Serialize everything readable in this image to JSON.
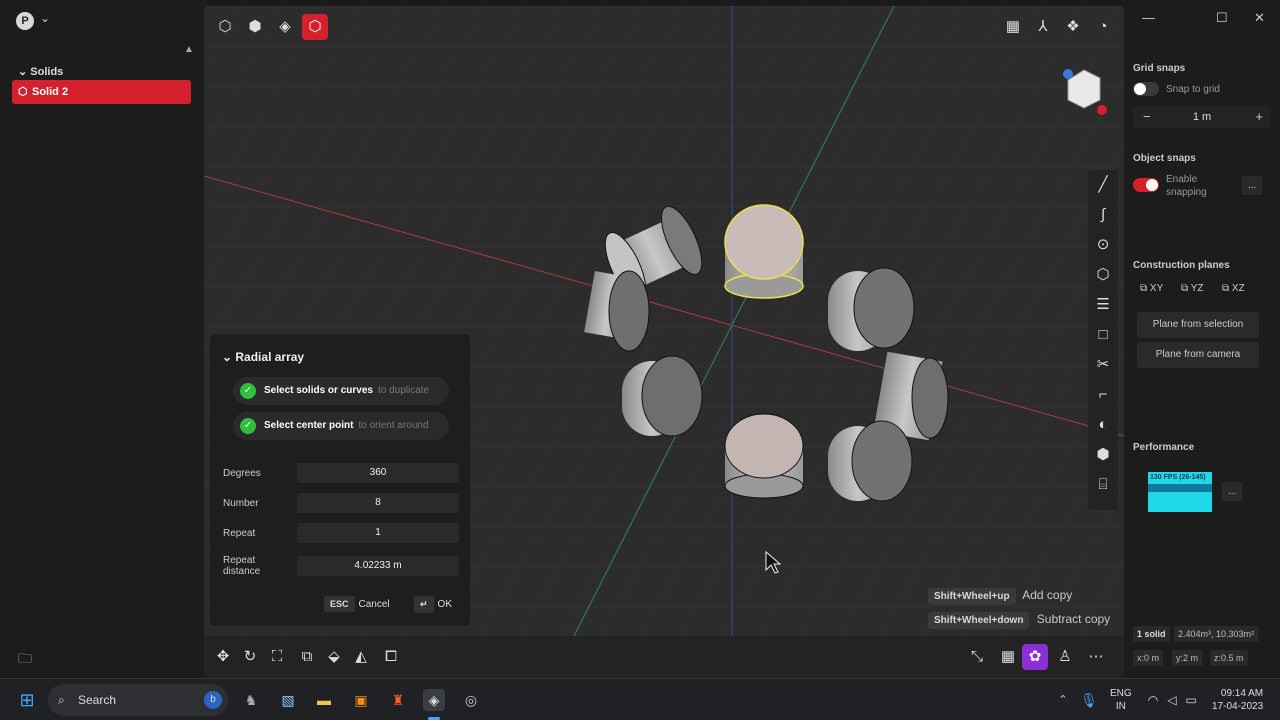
{
  "left_panel": {
    "avatar_letter": "P",
    "tree_header": "Solids",
    "tree_item": "Solid 2"
  },
  "viewport": {
    "hints": [
      {
        "keys": "Shift+Wheel+up",
        "action": "Add copy"
      },
      {
        "keys": "Shift+Wheel+down",
        "action": "Subtract copy"
      }
    ]
  },
  "dialog": {
    "title": "Radial array",
    "steps": [
      {
        "label": "Select solids or curves",
        "sub": "to duplicate"
      },
      {
        "label": "Select center point",
        "sub": "to orient around"
      }
    ],
    "fields": [
      {
        "label": "Degrees",
        "value": "360"
      },
      {
        "label": "Number",
        "value": "8"
      },
      {
        "label": "Repeat",
        "value": "1"
      },
      {
        "label": "Repeat distance",
        "value": "4.02233 m"
      }
    ],
    "esc_key": "ESC",
    "cancel": "Cancel",
    "ok": "OK"
  },
  "right_panel": {
    "grid_snaps": "Grid snaps",
    "snap_to_grid": "Snap to grid",
    "grid_value": "1 m",
    "object_snaps": "Object snaps",
    "enable_snapping": "Enable snapping",
    "construction_planes": "Construction planes",
    "planes": [
      "XY",
      "YZ",
      "XZ"
    ],
    "plane_from_selection": "Plane from selection",
    "plane_from_camera": "Plane from camera",
    "performance": "Performance",
    "fps": "130 FPS (26-145)",
    "more": "...",
    "status_solids": "1 solid",
    "status_area": "2.404m³, 10.303m²",
    "coords": [
      "x:0 m",
      "y:2 m",
      "z:0.5 m"
    ]
  },
  "taskbar": {
    "search": "Search",
    "lang1": "ENG",
    "lang2": "IN",
    "time": "09:14 AM",
    "date": "17-04-2023"
  },
  "colors": {
    "accent": "#d4212d",
    "purple": "#8b2fd6",
    "check": "#2fbf3a"
  }
}
